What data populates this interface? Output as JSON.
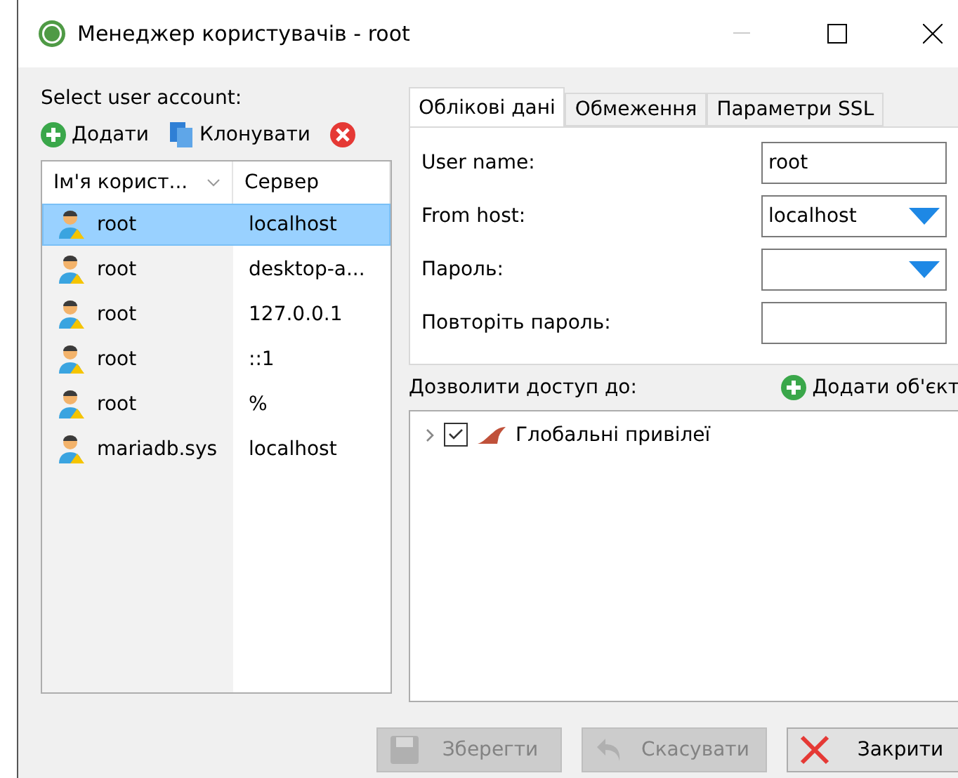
{
  "window": {
    "title": "Менеджер користувачів - root"
  },
  "accounts": {
    "label": "Select user account:",
    "toolbar": [
      {
        "kind": "add",
        "label": "Додати"
      },
      {
        "kind": "clone",
        "label": "Клонувати"
      },
      {
        "kind": "delete"
      }
    ],
    "columns": [
      "Ім'я корист...",
      "Сервер"
    ],
    "rows": [
      {
        "user": "root",
        "host": "localhost",
        "selected": true
      },
      {
        "user": "root",
        "host": "desktop-a...",
        "selected": false
      },
      {
        "user": "root",
        "host": "127.0.0.1",
        "selected": false
      },
      {
        "user": "root",
        "host": "::1",
        "selected": false
      },
      {
        "user": "root",
        "host": "%",
        "selected": false
      },
      {
        "user": "mariadb.sys",
        "host": "localhost",
        "selected": false
      }
    ]
  },
  "tabs": [
    {
      "label": "Облікові дані",
      "selected": true
    },
    {
      "label": "Обмеження",
      "selected": false
    },
    {
      "label": "Параметри SSL",
      "selected": false
    }
  ],
  "form": [
    {
      "label": "User name:",
      "kind": "text",
      "value": "root"
    },
    {
      "label": "From host:",
      "kind": "combo",
      "value": "localhost"
    },
    {
      "label": "Пароль:",
      "kind": "combo"
    },
    {
      "label": "Повторіть пароль:",
      "kind": "text"
    }
  ],
  "access": {
    "label": "Дозволити доступ до:",
    "add_label": "Додати об'єкт",
    "items": [
      {
        "label": "Глобальні привілеї",
        "checked": true,
        "expanded": false
      }
    ]
  },
  "buttons": [
    {
      "kind": "save",
      "label": "Зберегти",
      "disabled": true
    },
    {
      "kind": "cancel",
      "label": "Скасувати",
      "disabled": true
    },
    {
      "kind": "close",
      "label": "Закрити",
      "disabled": false
    }
  ]
}
